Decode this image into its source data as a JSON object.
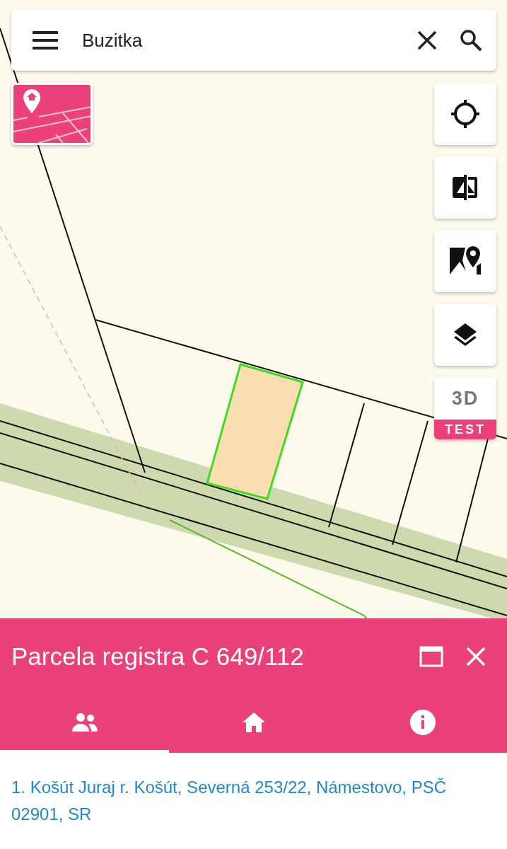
{
  "search": {
    "value": "Buzitka"
  },
  "map_buttons": [
    {
      "kind": "locate"
    },
    {
      "kind": "compare"
    },
    {
      "kind": "gmaps"
    },
    {
      "kind": "layers"
    }
  ],
  "button_3d": {
    "label": "3D",
    "badge": "TEST"
  },
  "panel": {
    "title": "Parcela registra C 649/112",
    "tabs": [
      {
        "kind": "owners",
        "selected": true
      },
      {
        "kind": "building",
        "selected": false
      },
      {
        "kind": "info",
        "selected": false
      }
    ],
    "owners": [
      "1. Košút Juraj r. Košút, Severná 253/22, Námestovo, PSČ 02901, SR"
    ]
  }
}
